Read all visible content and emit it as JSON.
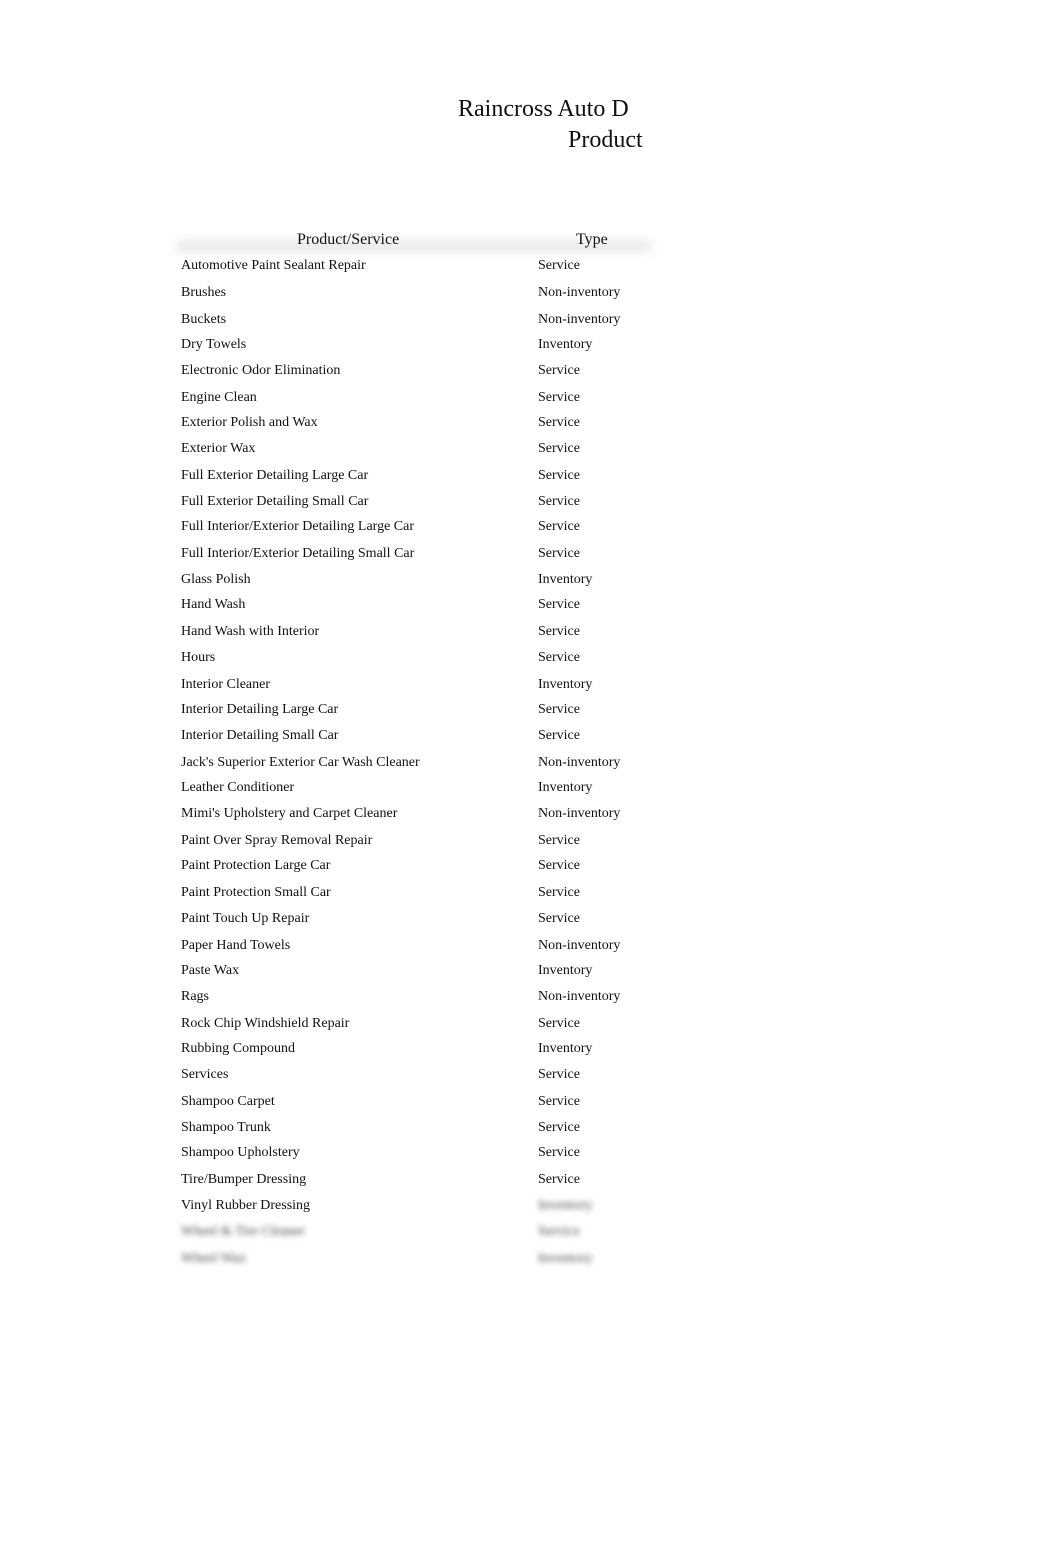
{
  "document": {
    "title_line1": "Raincross Auto D",
    "title_line2": "Product"
  },
  "table": {
    "headers": {
      "name": "Product/Service",
      "type": "Type"
    },
    "rows": [
      {
        "name": "Automotive Paint Sealant Repair",
        "type": "Service"
      },
      {
        "name": "Brushes",
        "type": "Non-inventory"
      },
      {
        "name": "Buckets",
        "type": "Non-inventory"
      },
      {
        "name": "Dry Towels",
        "type": "Inventory"
      },
      {
        "name": "Electronic Odor Elimination",
        "type": "Service"
      },
      {
        "name": "Engine Clean",
        "type": "Service"
      },
      {
        "name": "Exterior Polish and Wax",
        "type": "Service"
      },
      {
        "name": "Exterior Wax",
        "type": "Service"
      },
      {
        "name": "Full Exterior Detailing Large Car",
        "type": "Service"
      },
      {
        "name": "Full Exterior Detailing Small Car",
        "type": "Service"
      },
      {
        "name": "Full Interior/Exterior Detailing Large Car",
        "type": "Service"
      },
      {
        "name": "Full Interior/Exterior Detailing Small Car",
        "type": "Service"
      },
      {
        "name": "Glass Polish",
        "type": "Inventory"
      },
      {
        "name": "Hand Wash",
        "type": "Service"
      },
      {
        "name": "Hand Wash with Interior",
        "type": "Service"
      },
      {
        "name": "Hours",
        "type": "Service"
      },
      {
        "name": "Interior Cleaner",
        "type": "Inventory"
      },
      {
        "name": "Interior Detailing Large Car",
        "type": "Service"
      },
      {
        "name": "Interior Detailing Small Car",
        "type": "Service"
      },
      {
        "name": "Jack's Superior Exterior Car Wash Cleaner",
        "type": "Non-inventory"
      },
      {
        "name": "Leather Conditioner",
        "type": "Inventory"
      },
      {
        "name": "Mimi's Upholstery and Carpet Cleaner",
        "type": "Non-inventory"
      },
      {
        "name": "Paint Over Spray Removal Repair",
        "type": "Service"
      },
      {
        "name": "Paint Protection Large Car",
        "type": "Service"
      },
      {
        "name": "Paint Protection Small Car",
        "type": "Service"
      },
      {
        "name": "Paint Touch Up Repair",
        "type": "Service"
      },
      {
        "name": "Paper Hand Towels",
        "type": "Non-inventory"
      },
      {
        "name": "Paste Wax",
        "type": "Inventory"
      },
      {
        "name": "Rags",
        "type": "Non-inventory"
      },
      {
        "name": "Rock Chip Windshield Repair",
        "type": "Service"
      },
      {
        "name": "Rubbing Compound",
        "type": "Inventory"
      },
      {
        "name": "Services",
        "type": "Service"
      },
      {
        "name": "Shampoo Carpet",
        "type": "Service"
      },
      {
        "name": "Shampoo Trunk",
        "type": "Service"
      },
      {
        "name": "Shampoo Upholstery",
        "type": "Service"
      },
      {
        "name": "Tire/Bumper Dressing",
        "type": "Service"
      },
      {
        "name": "Vinyl Rubber Dressing",
        "type": "Inventory",
        "type_blurred": true
      },
      {
        "name": "Wheel & Tire Cleaner",
        "type": "Service",
        "blurred": true
      },
      {
        "name": "Wheel Wax",
        "type": "Inventory",
        "blurred": true
      }
    ]
  }
}
